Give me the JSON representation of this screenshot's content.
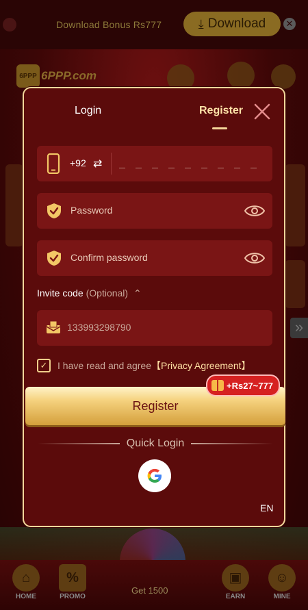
{
  "banner": {
    "bonus_text": "Download Bonus Rs777",
    "download_label": "Download"
  },
  "logo": {
    "text": "6PPP.com"
  },
  "bottom_nav": {
    "items": [
      "HOME",
      "PROMO",
      "EARN",
      "MINE"
    ],
    "center_label": "Get 1500"
  },
  "modal": {
    "tabs": {
      "login": "Login",
      "register": "Register"
    },
    "active_tab": "Register",
    "phone": {
      "country_code": "+92",
      "placeholder": "_ _ _ _ _ _ _ _ _ _"
    },
    "password": {
      "placeholder": "Password"
    },
    "confirm_password": {
      "placeholder": "Confirm password"
    },
    "invite": {
      "label": "Invite code",
      "optional": "(Optional)",
      "value": "133993298790"
    },
    "agreement": {
      "checked": true,
      "text": "I have read and agree",
      "link": "【Privacy Agreement】"
    },
    "register_button": "Register",
    "reward_badge": "+Rs27~777",
    "quick_login": "Quick Login",
    "language": "EN"
  },
  "colors": {
    "modal_bg": "#5b0b0b",
    "field_bg": "#7a1515",
    "gold": "#f2d79b",
    "badge_red": "#d62121"
  }
}
